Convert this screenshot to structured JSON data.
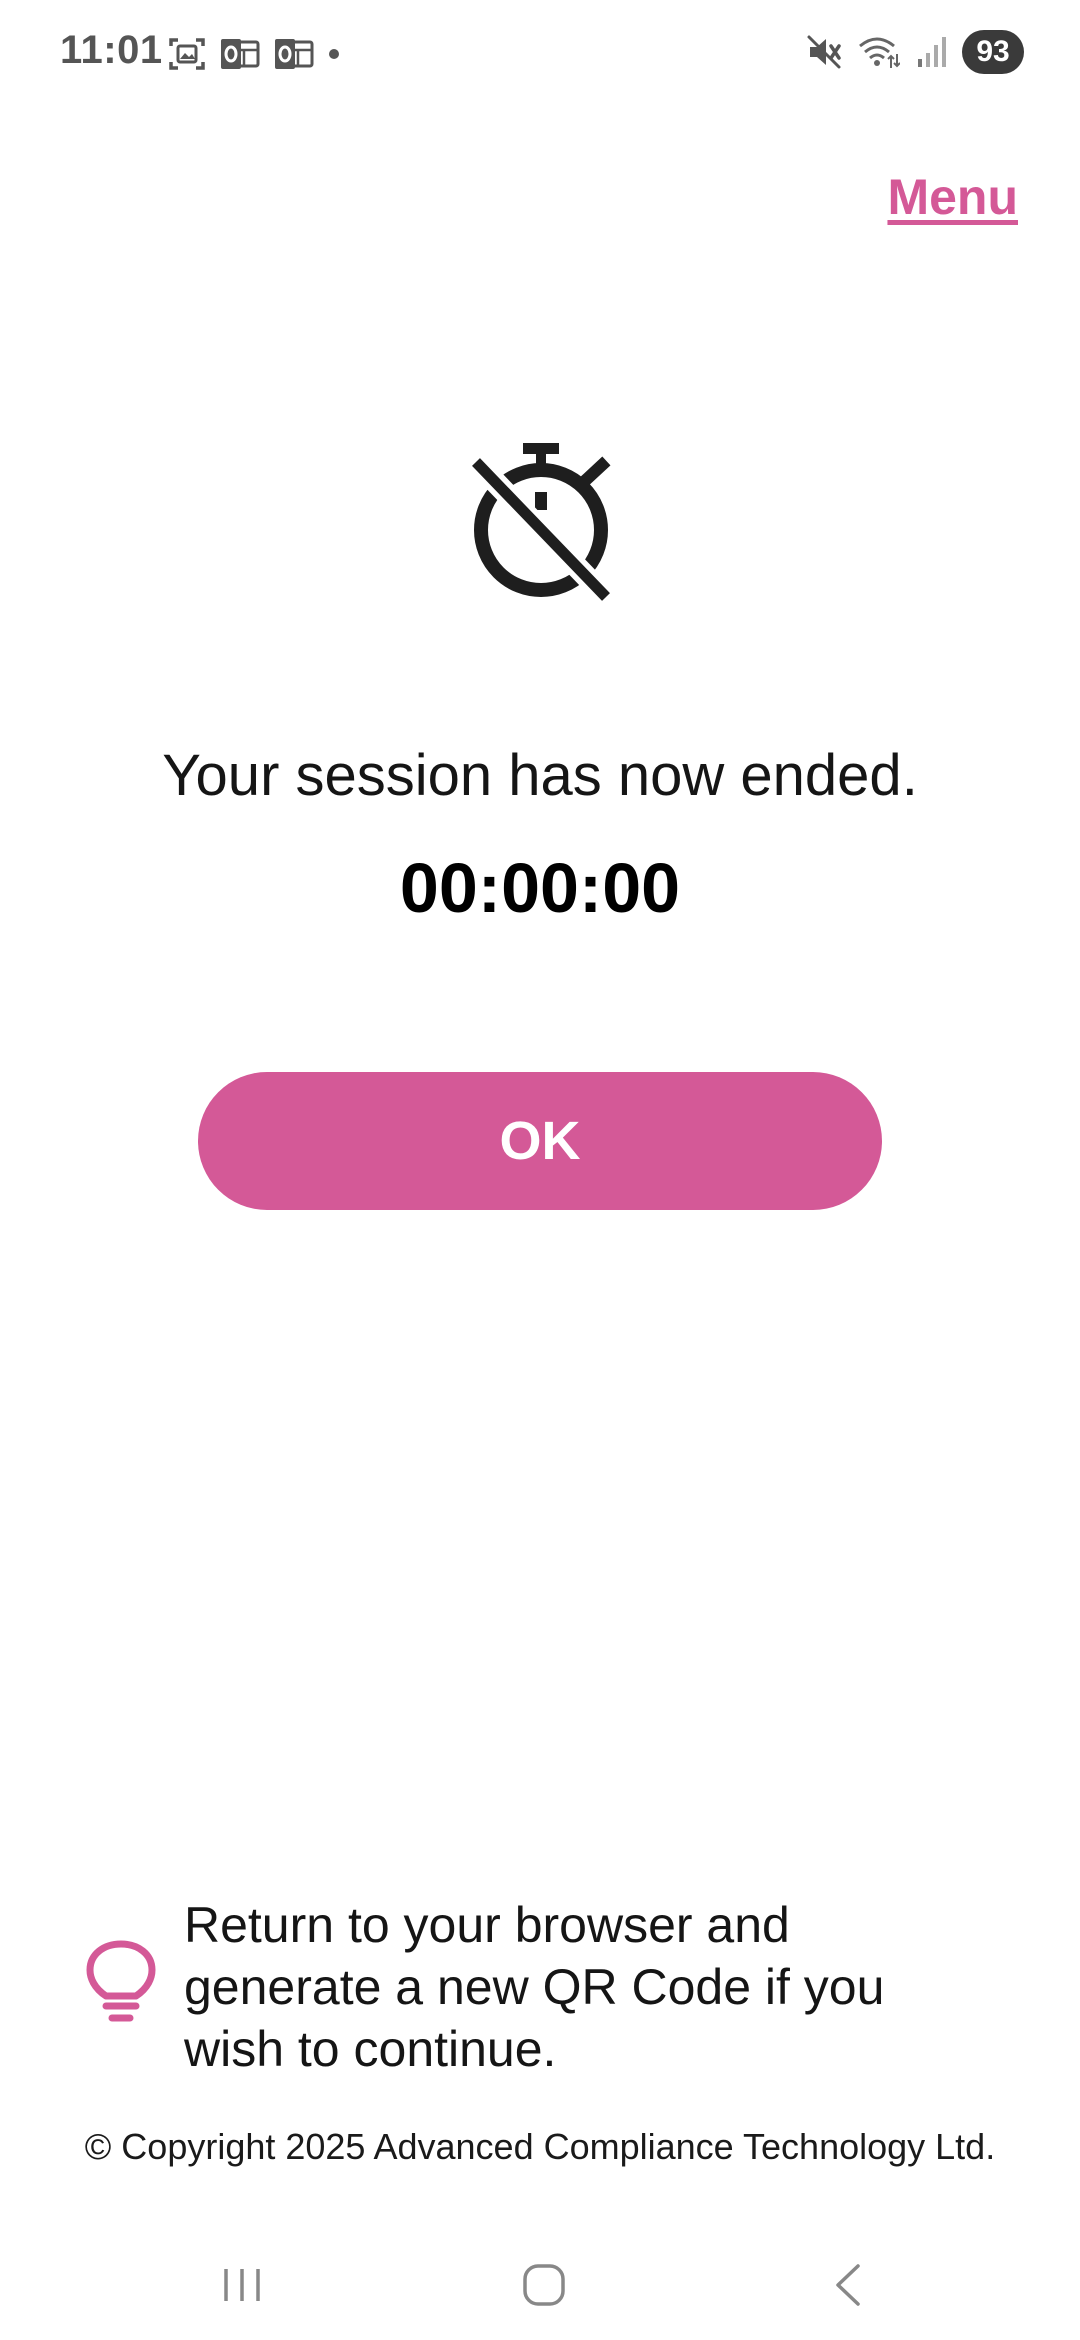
{
  "status_bar": {
    "time": "11:01",
    "notification_icons": [
      "screenshot-icon",
      "outlook-icon",
      "outlook-icon",
      "dot-icon"
    ],
    "system_icons": [
      "mute-icon",
      "wifi-icon",
      "signal-icon"
    ],
    "battery_level": "93"
  },
  "header": {
    "menu_label": "Menu"
  },
  "main": {
    "icon": "timer-off-icon",
    "message": "Your session has now ended.",
    "timer": "00:00:00",
    "ok_label": "OK"
  },
  "tip": {
    "icon": "lightbulb-icon",
    "text": "Return to your browser and generate a new QR Code if you wish to continue."
  },
  "footer": {
    "copyright": "© Copyright 2025 Advanced Compliance Technology Ltd."
  },
  "colors": {
    "accent": "#d45997",
    "text": "#151515",
    "background": "#ffffff"
  },
  "nav_bar": {
    "buttons": [
      "recents-icon",
      "home-icon",
      "back-icon"
    ]
  }
}
